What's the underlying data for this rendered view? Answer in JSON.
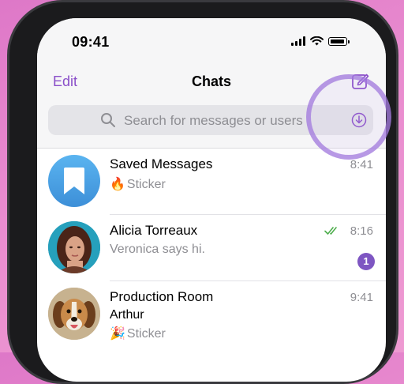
{
  "status_bar": {
    "time": "09:41"
  },
  "header": {
    "edit_label": "Edit",
    "title": "Chats",
    "compose_icon": "compose-icon"
  },
  "search": {
    "placeholder": "Search for messages or users"
  },
  "colors": {
    "accent": "#8a4fc9",
    "badge": "#7e56c2",
    "read_check": "#4fae4e",
    "highlight_ring": "#a078dc"
  },
  "chats": [
    {
      "name": "Saved Messages",
      "time": "8:41",
      "preview_emoji": "🔥",
      "preview": "Sticker",
      "avatar_icon": "bookmark-icon"
    },
    {
      "name": "Alicia Torreaux",
      "time": "8:16",
      "preview": "Veronica says hi.",
      "unread": "1",
      "read_status": "double-check-icon"
    },
    {
      "name": "Production Room",
      "time": "9:41",
      "sender": "Arthur",
      "preview_emoji": "🎉",
      "preview": "Sticker"
    }
  ]
}
